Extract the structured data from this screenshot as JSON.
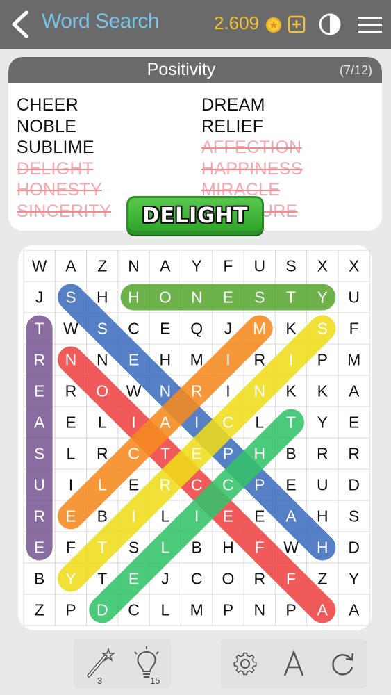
{
  "header": {
    "title": "Word Search",
    "coins": "2.609",
    "icons": [
      "back-icon",
      "coin-icon",
      "add-coins-icon",
      "contrast-icon",
      "menu-icon"
    ]
  },
  "panel": {
    "title": "Positivity",
    "count": "(7/12)",
    "words": [
      {
        "text": "CHEER",
        "found": false
      },
      {
        "text": "NOBLE",
        "found": false
      },
      {
        "text": "SUBLIME",
        "found": false
      },
      {
        "text": "DELIGHT",
        "found": true
      },
      {
        "text": "HONESTY",
        "found": true
      },
      {
        "text": "SINCERITY",
        "found": true
      },
      {
        "text": "DREAM",
        "found": false
      },
      {
        "text": "RELIEF",
        "found": false
      },
      {
        "text": "AFFECTION",
        "found": true
      },
      {
        "text": "HAPPINESS",
        "found": true
      },
      {
        "text": "MIRACLE",
        "found": true
      },
      {
        "text": "TREASURE",
        "found": true
      }
    ]
  },
  "popup": {
    "text": "DELIGHT"
  },
  "grid": [
    [
      "W",
      "A",
      "Z",
      "N",
      "A",
      "Y",
      "F",
      "U",
      "S",
      "X",
      "X"
    ],
    [
      "J",
      "S",
      "H",
      "H",
      "O",
      "N",
      "E",
      "S",
      "T",
      "Y",
      "U"
    ],
    [
      "T",
      "W",
      "S",
      "C",
      "E",
      "Q",
      "J",
      "M",
      "K",
      "S",
      "F"
    ],
    [
      "R",
      "N",
      "N",
      "E",
      "H",
      "M",
      "I",
      "R",
      "I",
      "P",
      "M"
    ],
    [
      "E",
      "R",
      "O",
      "W",
      "N",
      "R",
      "I",
      "N",
      "K",
      "K",
      "A"
    ],
    [
      "A",
      "E",
      "L",
      "I",
      "A",
      "I",
      "C",
      "L",
      "T",
      "Y",
      "E"
    ],
    [
      "S",
      "L",
      "R",
      "C",
      "T",
      "E",
      "P",
      "H",
      "B",
      "R",
      "R"
    ],
    [
      "U",
      "I",
      "L",
      "E",
      "R",
      "C",
      "C",
      "P",
      "E",
      "U",
      "D"
    ],
    [
      "R",
      "E",
      "B",
      "I",
      "L",
      "I",
      "E",
      "E",
      "A",
      "H",
      "S"
    ],
    [
      "E",
      "F",
      "T",
      "S",
      "L",
      "B",
      "H",
      "F",
      "W",
      "H",
      "D"
    ],
    [
      "B",
      "Y",
      "T",
      "E",
      "J",
      "C",
      "O",
      "R",
      "F",
      "Z",
      "Y"
    ],
    [
      "Z",
      "P",
      "D",
      "C",
      "L",
      "M",
      "P",
      "N",
      "P",
      "A",
      "A"
    ]
  ],
  "found_lines": [
    {
      "word": "TREASURE",
      "from": [
        2,
        0
      ],
      "to": [
        9,
        0
      ],
      "color": "#7b5a93"
    },
    {
      "word": "HONESTY",
      "from": [
        1,
        3
      ],
      "to": [
        1,
        9
      ],
      "color": "#5aa832"
    },
    {
      "word": "SINCERITY",
      "from": [
        1,
        1
      ],
      "to": [
        9,
        9
      ],
      "color": "#3f6fbf"
    },
    {
      "word": "AFFECTION",
      "from": [
        3,
        1
      ],
      "to": [
        11,
        9
      ],
      "color": "#ef4444"
    },
    {
      "word": "HAPPINESS",
      "from": [
        8,
        1
      ],
      "to": [
        2,
        7
      ],
      "color": "#f58a1f"
    },
    {
      "word": "MIRACLE",
      "from": [
        2,
        9
      ],
      "to": [
        10,
        1
      ],
      "color": "#f0dc1a"
    },
    {
      "word": "DELIGHT",
      "from": [
        11,
        2
      ],
      "to": [
        5,
        8
      ],
      "color": "#34c36a"
    }
  ],
  "toolbar": {
    "hints": [
      {
        "name": "magic-wand-icon",
        "count": "3"
      },
      {
        "name": "lightbulb-icon",
        "count": "15"
      }
    ],
    "actions": [
      "gear-icon",
      "font-size-icon",
      "refresh-icon"
    ]
  }
}
